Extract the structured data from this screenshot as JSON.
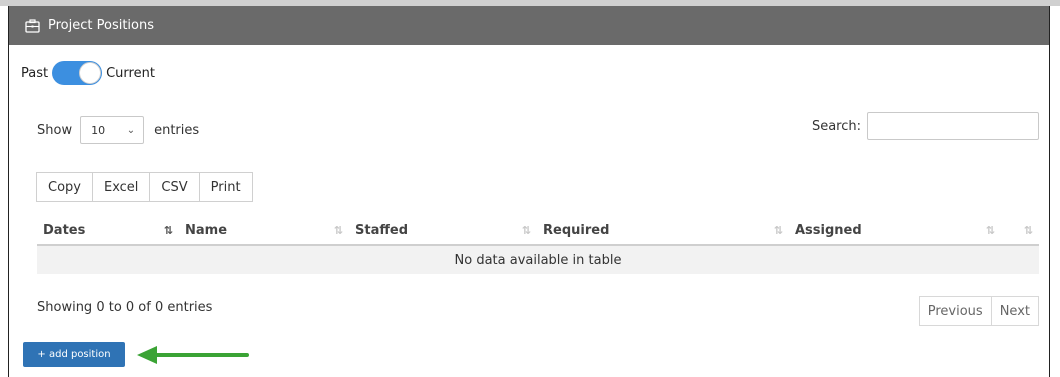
{
  "panel": {
    "title": "Project Positions",
    "icon": "briefcase-icon"
  },
  "toggle": {
    "left_label": "Past",
    "right_label": "Current",
    "state": "Current",
    "color": "#3c8fe0"
  },
  "length_menu": {
    "prefix": "Show",
    "selected": "10",
    "suffix": "entries"
  },
  "search": {
    "label": "Search:",
    "value": "",
    "placeholder": ""
  },
  "export_buttons": [
    "Copy",
    "Excel",
    "CSV",
    "Print"
  ],
  "table": {
    "columns": [
      "Dates",
      "Name",
      "Staffed",
      "Required",
      "Assigned",
      ""
    ],
    "empty_message": "No data available in table"
  },
  "info": {
    "text": "Showing 0 to 0 of 0 entries"
  },
  "pagination": {
    "previous": "Previous",
    "next": "Next"
  },
  "add_button": {
    "label": "+ add position",
    "color": "#2f73b5"
  },
  "annotation": {
    "icon": "arrow-left-icon",
    "color": "#3aa335"
  }
}
